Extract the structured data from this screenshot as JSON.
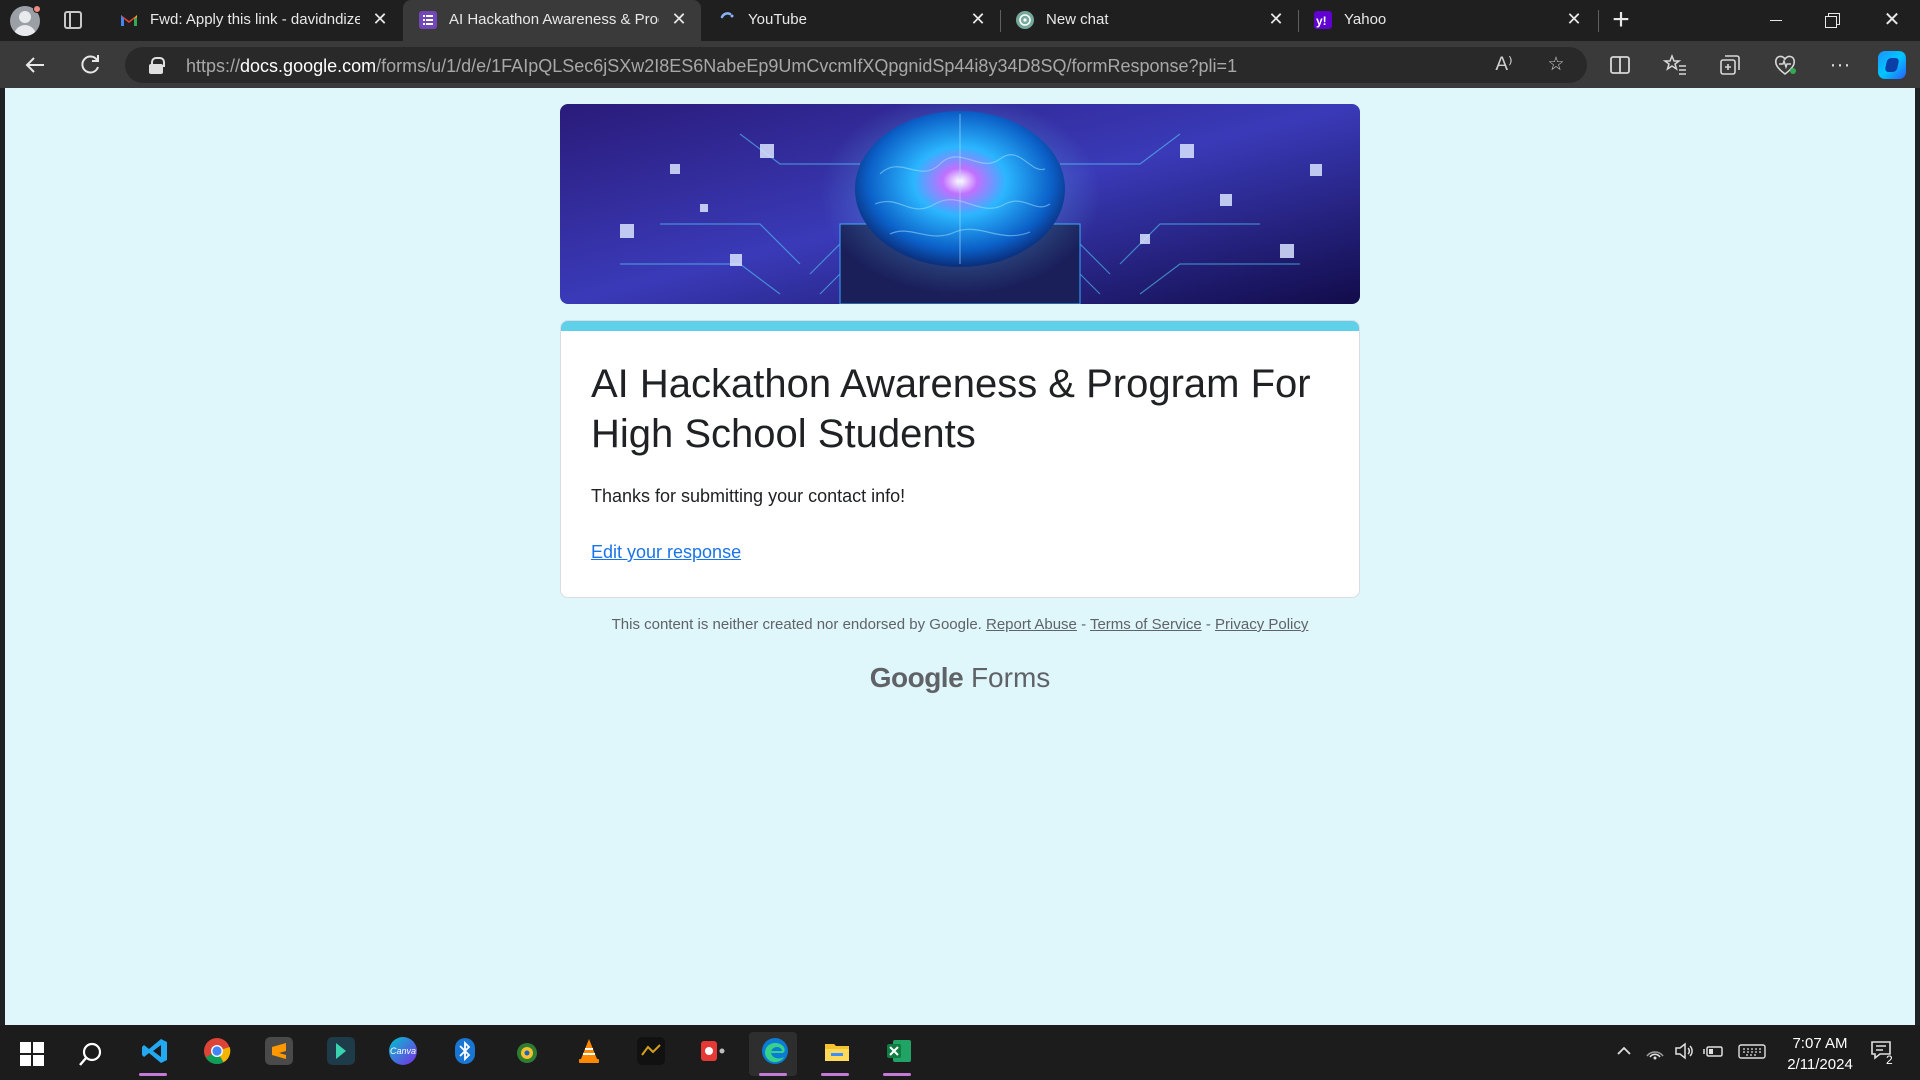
{
  "browser": {
    "tabs": [
      {
        "title": "Fwd: Apply this link - davidndize",
        "favicon": "gmail-icon",
        "active": false
      },
      {
        "title": "AI Hackathon Awareness & Prog",
        "favicon": "google-forms-icon",
        "active": true
      },
      {
        "title": "YouTube",
        "favicon": "youtube-loading-icon",
        "active": false
      },
      {
        "title": "New chat",
        "favicon": "chatgpt-icon",
        "active": false
      },
      {
        "title": "Yahoo",
        "favicon": "yahoo-icon",
        "active": false
      }
    ],
    "url_prefix": "https://",
    "url_host": "docs.google.com",
    "url_path": "/forms/u/1/d/e/1FAIpQLSec6jSXw2I8ES6NabeEp9UmCvcmIfXQpgnidSp44i8y34D8SQ/formResponse?pli=1",
    "read_aloud_label": "A⁾"
  },
  "form": {
    "title": "AI Hackathon Awareness & Program For High School Students",
    "confirmation": "Thanks for submitting your contact info!",
    "edit_link": "Edit your response",
    "accent_color": "#5ed0ea",
    "background_color": "#dff6fa"
  },
  "footer": {
    "disclaimer": "This content is neither created nor endorsed by Google.",
    "report_abuse": "Report Abuse",
    "sep1": " - ",
    "terms": "Terms of Service",
    "sep2": " - ",
    "privacy": "Privacy Policy",
    "brand_google": "Google",
    "brand_forms": "Forms"
  },
  "taskbar": {
    "apps": [
      "windows-start-icon",
      "search-icon",
      "vscode-icon",
      "chrome-icon",
      "sublime-text-icon",
      "app-icon",
      "canva-icon",
      "bluetooth-icon",
      "app-icon",
      "vlc-icon",
      "app-icon",
      "app-icon",
      "edge-icon",
      "file-explorer-icon",
      "excel-icon"
    ],
    "canva_label": "Canva",
    "time": "7:07 AM",
    "date": "2/11/2024",
    "notification_count": "2"
  }
}
